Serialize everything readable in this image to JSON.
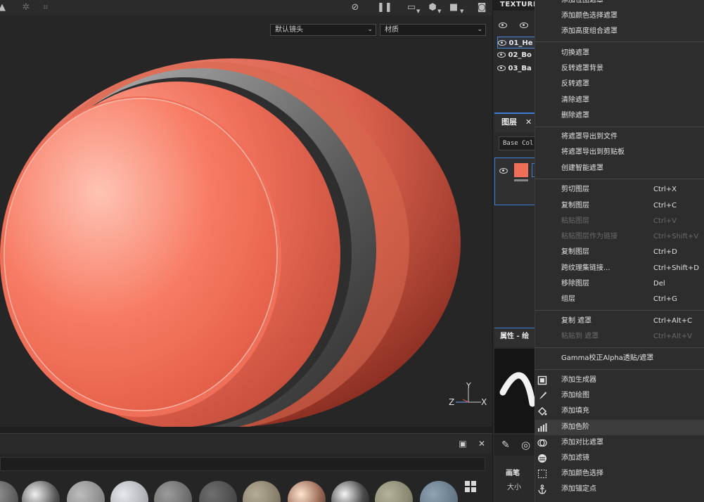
{
  "viewport": {
    "camera_select": "默认镜头",
    "shading_select": "材质",
    "axis": {
      "x": "X",
      "y": "Y",
      "z": "Z"
    },
    "toolbar_icons": [
      "perspective-icon",
      "axis-icon",
      "transform-icon",
      "hide-ui-icon",
      "pause-icon",
      "view-mode-icon",
      "cube-icon",
      "camera-icon",
      "screenshot-icon"
    ]
  },
  "texture_set": {
    "title": "TEXTURE",
    "rows": [
      {
        "label": "01_He",
        "selected": true
      },
      {
        "label": "02_Bo",
        "selected": false
      },
      {
        "label": "03_Ba",
        "selected": false
      }
    ]
  },
  "layers": {
    "tab": "图层",
    "channel": "Base Col"
  },
  "properties": {
    "tab": "属性 - 绘",
    "brush_label": "画笔",
    "size_label": "大小"
  },
  "colors": {
    "accent": "#3d7fd6",
    "material": "#ef6e57",
    "menu_bg": "#2d2d2d",
    "highlight": "#3c3c3c"
  },
  "context_menu": {
    "items": [
      {
        "label": "添加位图遮罩",
        "shortcut": "",
        "disabled": false,
        "icon": ""
      },
      {
        "label": "添加颜色选择遮罩",
        "shortcut": "",
        "disabled": false,
        "icon": ""
      },
      {
        "label": "添加高度组合遮罩",
        "shortcut": "",
        "disabled": false,
        "icon": ""
      },
      {
        "sep": true
      },
      {
        "label": "切换遮罩",
        "shortcut": "",
        "disabled": false,
        "icon": ""
      },
      {
        "label": "反转遮罩背景",
        "shortcut": "",
        "disabled": false,
        "icon": ""
      },
      {
        "label": "反转遮罩",
        "shortcut": "",
        "disabled": false,
        "icon": ""
      },
      {
        "label": "清除遮罩",
        "shortcut": "",
        "disabled": false,
        "icon": ""
      },
      {
        "label": "删除遮罩",
        "shortcut": "",
        "disabled": false,
        "icon": ""
      },
      {
        "sep": true
      },
      {
        "label": "将遮罩导出到文件",
        "shortcut": "",
        "disabled": false,
        "icon": ""
      },
      {
        "label": "将遮罩导出到剪贴板",
        "shortcut": "",
        "disabled": false,
        "icon": ""
      },
      {
        "label": "创建智能遮罩",
        "shortcut": "",
        "disabled": false,
        "icon": ""
      },
      {
        "sep": true
      },
      {
        "label": "剪切图层",
        "shortcut": "Ctrl+X",
        "disabled": false,
        "icon": ""
      },
      {
        "label": "复制图层",
        "shortcut": "Ctrl+C",
        "disabled": false,
        "icon": ""
      },
      {
        "label": "粘贴图层",
        "shortcut": "Ctrl+V",
        "disabled": true,
        "icon": ""
      },
      {
        "label": "粘贴图层作为链接",
        "shortcut": "Ctrl+Shift+V",
        "disabled": true,
        "icon": ""
      },
      {
        "label": "复制图层",
        "shortcut": "Ctrl+D",
        "disabled": false,
        "icon": ""
      },
      {
        "label": "跨纹理集链接...",
        "shortcut": "Ctrl+Shift+D",
        "disabled": false,
        "icon": ""
      },
      {
        "label": "移除图层",
        "shortcut": "Del",
        "disabled": false,
        "icon": ""
      },
      {
        "label": "组层",
        "shortcut": "Ctrl+G",
        "disabled": false,
        "icon": ""
      },
      {
        "sep": true
      },
      {
        "label": "复制 遮罩",
        "shortcut": "Ctrl+Alt+C",
        "disabled": false,
        "icon": ""
      },
      {
        "label": "粘贴到 遮罩",
        "shortcut": "Ctrl+Alt+V",
        "disabled": true,
        "icon": ""
      },
      {
        "sep": true
      },
      {
        "label": "Gamma校正Alpha透贴/遮罩",
        "shortcut": "",
        "disabled": false,
        "icon": ""
      },
      {
        "sep": true
      },
      {
        "label": "添加生成器",
        "shortcut": "",
        "disabled": false,
        "icon": "generator-icon"
      },
      {
        "label": "添加绘图",
        "shortcut": "",
        "disabled": false,
        "icon": "paint-brush-icon"
      },
      {
        "label": "添加填充",
        "shortcut": "",
        "disabled": false,
        "icon": "fill-bucket-icon"
      },
      {
        "label": "添加色阶",
        "shortcut": "",
        "disabled": false,
        "icon": "levels-icon",
        "highlighted": true
      },
      {
        "label": "添加对比遮罩",
        "shortcut": "",
        "disabled": false,
        "icon": "compare-mask-icon"
      },
      {
        "label": "添加滤镜",
        "shortcut": "",
        "disabled": false,
        "icon": "filter-icon"
      },
      {
        "label": "添加颜色选择",
        "shortcut": "",
        "disabled": false,
        "icon": "color-selection-icon"
      },
      {
        "label": "添加锚定点",
        "shortcut": "",
        "disabled": false,
        "icon": "anchor-icon"
      }
    ]
  }
}
